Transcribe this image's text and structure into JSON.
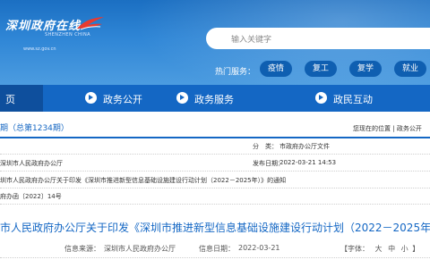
{
  "header": {
    "logo_title": "深圳政府在线",
    "logo_subtitle": "SHENZHEN CHINA",
    "logo_url": "www.sz.gov.cn",
    "search_placeholder": "输入关键字",
    "hot_label": "热门服务：",
    "hot_buttons": [
      "疫情",
      "复工",
      "复学",
      "就业"
    ]
  },
  "nav": {
    "home": "页",
    "items": [
      "政务公开",
      "政务服务",
      "政民互动"
    ]
  },
  "issue": "期（总第1234期）",
  "location": {
    "prefix": "您现在的位置",
    "separator": "|",
    "link": "政务公开"
  },
  "info": {
    "row1_left": "深圳市人民政府办公厅",
    "row1_right_label": "发布日期：",
    "row1_right_value": "2022-03-21 14:53",
    "row0_right_label": "分　类：",
    "row0_right_value": "市政府办公厅文件",
    "row2": "圳市人民政府办公厅关于印发《深圳市推进新型信息基础设施建设行动计划（2022－2025年）》的通知",
    "row3": "府办函〔2022〕14号"
  },
  "doc": {
    "title": "市人民政府办公厅关于印发《深圳市推进新型信息基础设施建设行动计划（2022－2025年）》",
    "source_label": "信息来源：",
    "source": "深圳市人民政府办公厅",
    "date_label": "信息日期：",
    "date": "2022-03-21",
    "font_label": "【字体：",
    "font_sizes": [
      "大",
      "中",
      "小"
    ],
    "font_close": "】"
  },
  "colors": {
    "brand_blue": "#1467c4",
    "nav_home": "#0e4f9d",
    "hot_button": "#0f5fb1"
  }
}
